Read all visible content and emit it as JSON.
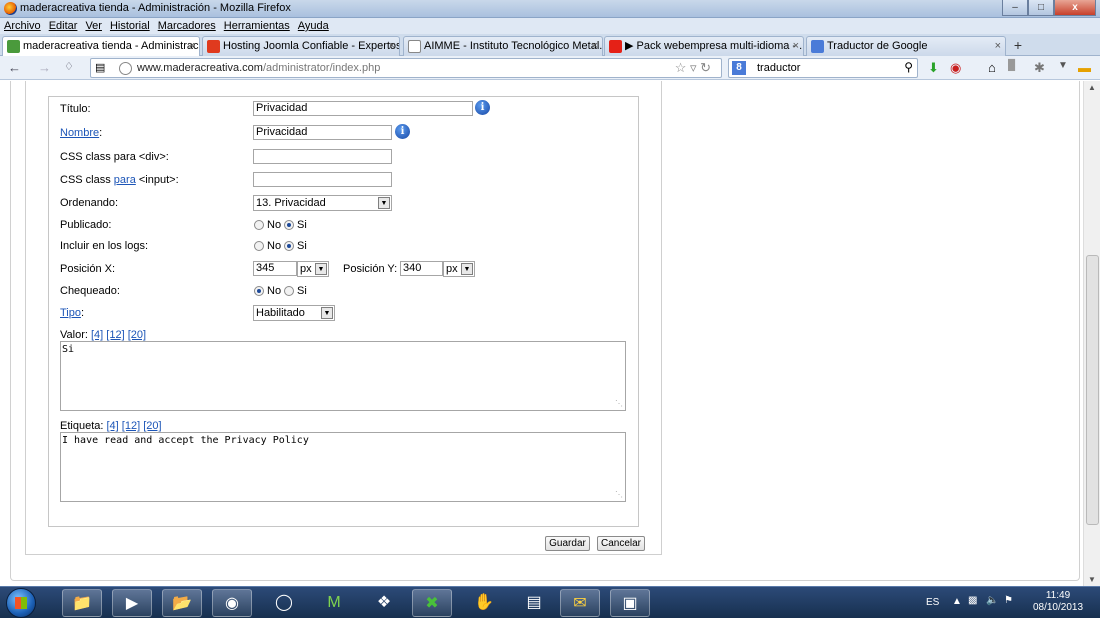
{
  "window": {
    "title": "maderacreativa tienda - Administración - Mozilla Firefox",
    "minimize": "–",
    "maximize": "□",
    "close": "x"
  },
  "menu": [
    "Archivo",
    "Editar",
    "Ver",
    "Historial",
    "Marcadores",
    "Herramientas",
    "Ayuda"
  ],
  "tabs": [
    {
      "label": "maderacreativa tienda - Administraci...",
      "color": "#4a9a3c"
    },
    {
      "label": "Hosting Joomla Confiable - Expertos ...",
      "color": "#e03a1e"
    },
    {
      "label": "AIMME - Instituto Tecnológico Metal...",
      "color": "#ffffff"
    },
    {
      "label": "▶ Pack webempresa multi-idioma - ...",
      "color": "#e52117"
    },
    {
      "label": "Traductor de Google",
      "color": "#4a7bd8"
    }
  ],
  "tab_close": "×",
  "new_tab": "+",
  "nav": {
    "url_host": "www.maderacreativa.com",
    "url_path": "/administrator/index.php",
    "search_query": "traductor",
    "search_engine": "8"
  },
  "form": {
    "titulo_label": "Título:",
    "titulo_value": "Privacidad",
    "nombre_label": "Nombre",
    "nombre_suffix": ":",
    "nombre_value": "Privacidad",
    "css_div_label": "CSS class para <div>:",
    "css_input_label_pre": "CSS class ",
    "css_input_link": "para",
    "css_input_label_post": " <input>:",
    "ordenando_label": "Ordenando:",
    "ordenando_value": "13. Privacidad",
    "publicado_label": "Publicado:",
    "logs_label": "Incluir en los logs:",
    "chequeado_label": "Chequeado:",
    "no": "No",
    "si": "Si",
    "posx_label": "Posición X:",
    "posx_value": "345",
    "posy_label": "Posición Y:",
    "posy_value": "340",
    "unit": "px",
    "tipo_label": "Tipo",
    "tipo_suffix": ":",
    "tipo_value": "Habilitado",
    "valor_label": "Valor:",
    "valor_text": "Si",
    "etiqueta_label": "Etiqueta:",
    "etiqueta_text": "I have read and accept the Privacy Policy",
    "size_links": [
      "[4]",
      "[12]",
      "[20]"
    ],
    "info": "i",
    "publicado_selected": "si",
    "logs_selected": "si",
    "chequeado_selected": "no"
  },
  "buttons": {
    "guardar": "Guardar",
    "cancelar": "Cancelar"
  },
  "taskbar": {
    "lang": "ES",
    "time": "11:49",
    "date": "08/10/2013"
  }
}
